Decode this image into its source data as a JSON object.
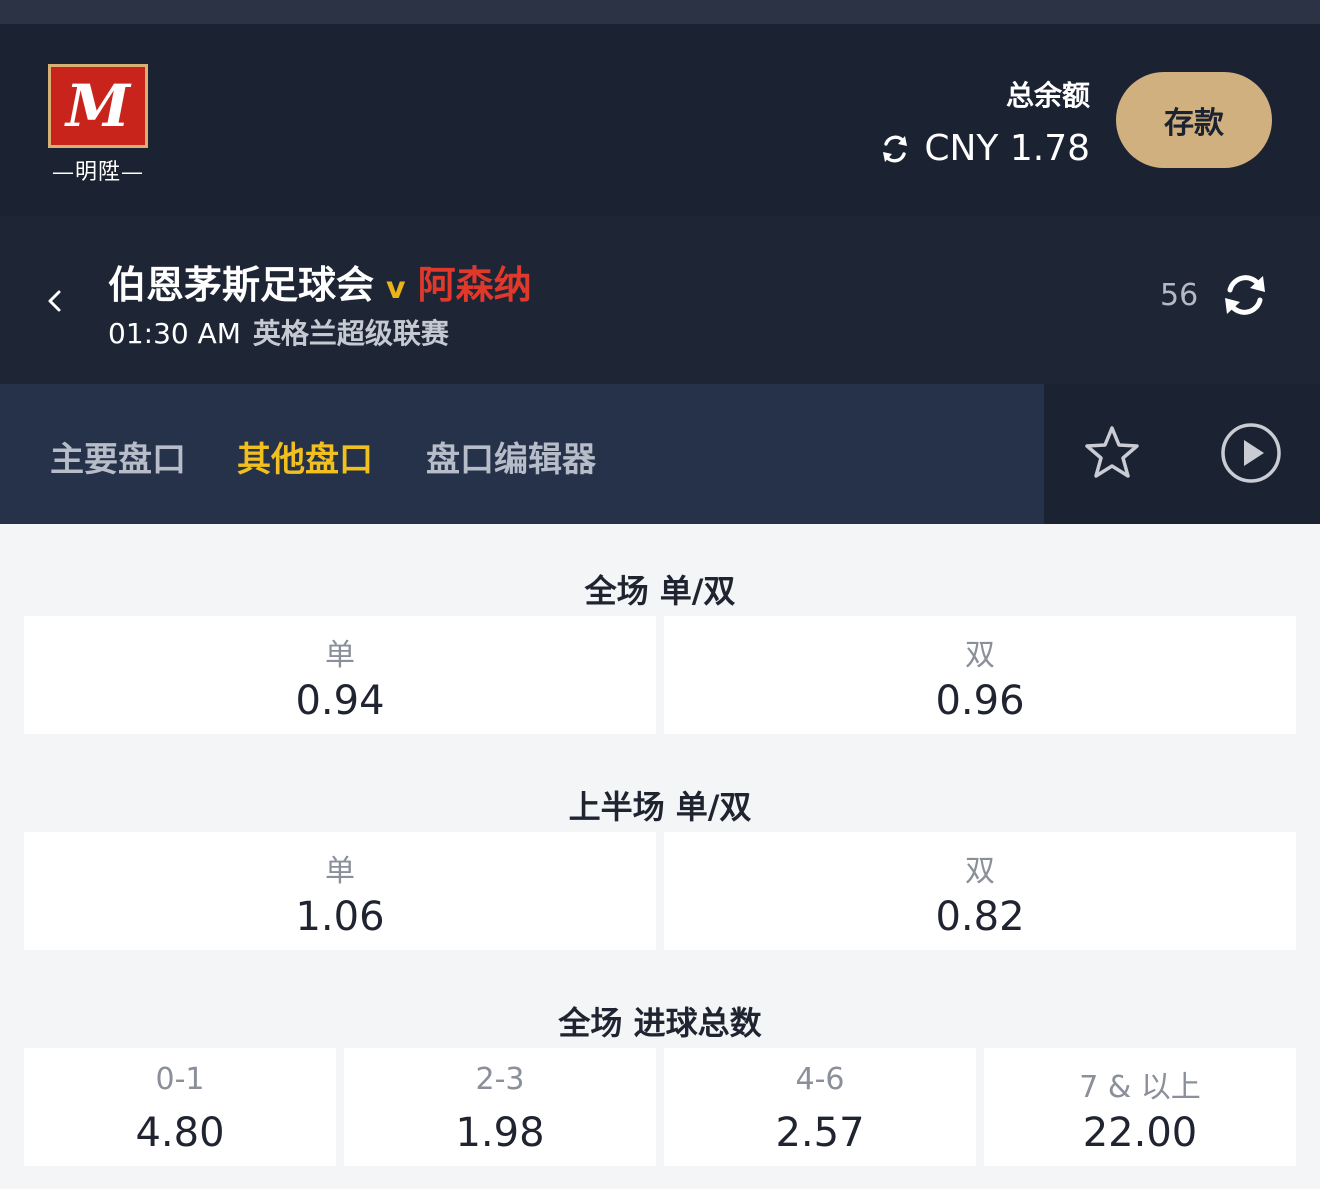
{
  "header": {
    "logo_letter": "M",
    "logo_sub": "—明陞—",
    "balance_label": "总余额",
    "balance_value": "CNY 1.78",
    "deposit_label": "存款"
  },
  "match": {
    "home_team": "伯恩茅斯足球会",
    "vs": "v",
    "away_team": "阿森纳",
    "time": "01:30 AM",
    "league": "英格兰超级联赛",
    "market_count": "56"
  },
  "tabs": [
    {
      "label": "主要盘口",
      "active": false
    },
    {
      "label": "其他盘口",
      "active": true
    },
    {
      "label": "盘口编辑器",
      "active": false
    }
  ],
  "markets": [
    {
      "title": "全场 单/双",
      "options": [
        {
          "label": "单",
          "odds": "0.94"
        },
        {
          "label": "双",
          "odds": "0.96"
        }
      ]
    },
    {
      "title": "上半场 单/双",
      "options": [
        {
          "label": "单",
          "odds": "1.06"
        },
        {
          "label": "双",
          "odds": "0.82"
        }
      ]
    },
    {
      "title": "全场 进球总数",
      "options": [
        {
          "label": "0-1",
          "odds": "4.80"
        },
        {
          "label": "2-3",
          "odds": "1.98"
        },
        {
          "label": "4-6",
          "odds": "2.57"
        },
        {
          "label": "7 & 以上",
          "odds": "22.00"
        }
      ]
    }
  ],
  "colors": {
    "header_bg": "#1b2231",
    "tabs_bg": "#26324a",
    "active_tab": "#f2c01e",
    "away_team": "#e0392b",
    "deposit_btn": "#cfb07e"
  }
}
